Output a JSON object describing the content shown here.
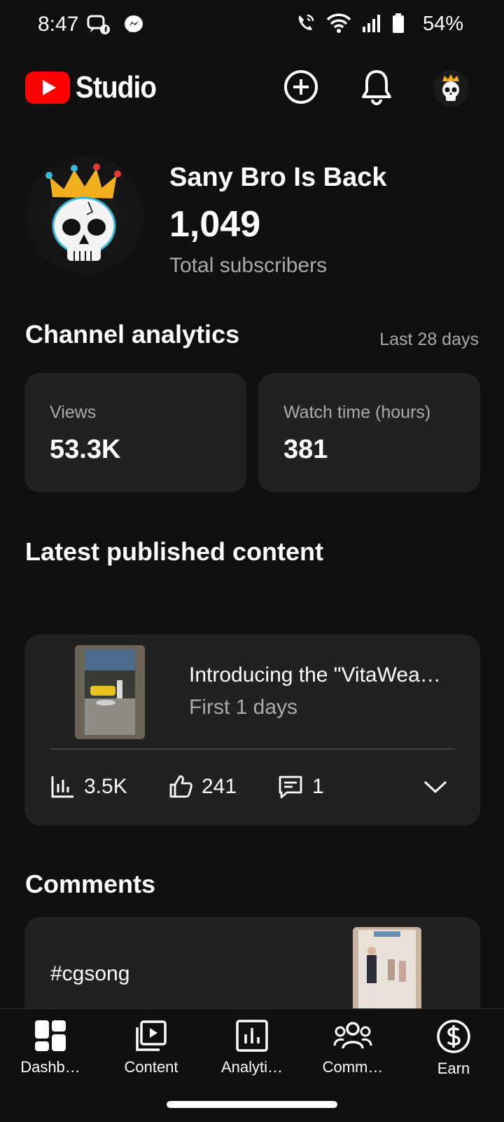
{
  "status_bar": {
    "time": "8:47",
    "battery": "54%"
  },
  "header": {
    "logo_text": "Studio",
    "accent": "#ff0000"
  },
  "channel": {
    "name": "Sany Bro Is Back",
    "subscribers": "1,049",
    "subscribers_label": "Total subscribers"
  },
  "analytics": {
    "title": "Channel analytics",
    "period": "Last 28 days",
    "stats": [
      {
        "label": "Views",
        "value": "53.3K"
      },
      {
        "label": "Watch time (hours)",
        "value": "381"
      }
    ]
  },
  "latest": {
    "title": "Latest published content",
    "video": {
      "title": "Introducing the \"VitaWea…",
      "subtitle": "First 1 days",
      "views": "3.5K",
      "likes": "241",
      "comments": "1"
    }
  },
  "comments": {
    "title": "Comments",
    "first_comment": "#cgsong"
  },
  "nav": {
    "items": [
      {
        "label": "Dashb…",
        "icon": "dashboard-icon"
      },
      {
        "label": "Content",
        "icon": "content-icon"
      },
      {
        "label": "Analyti…",
        "icon": "analytics-icon"
      },
      {
        "label": "Comm…",
        "icon": "community-icon"
      },
      {
        "label": "Earn",
        "icon": "earn-icon"
      }
    ]
  }
}
